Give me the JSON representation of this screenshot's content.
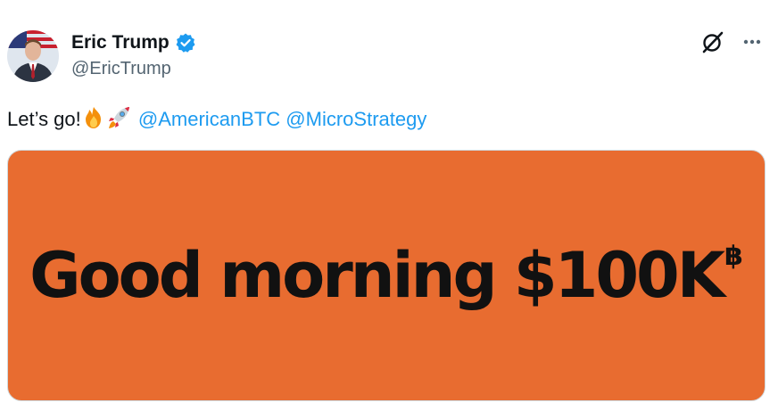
{
  "author": {
    "display_name": "Eric Trump",
    "handle": "@EricTrump",
    "verified_color": "#1d9bf0",
    "avatar_icon": "profile-photo"
  },
  "actions": {
    "grok_icon": "grok-icon",
    "more_icon": "more-dots-icon"
  },
  "tweet": {
    "text": "Let’s go!",
    "emoji_1": "fire-emoji",
    "emoji_2": "rocket-emoji",
    "mentions": [
      "@AmericanBTC",
      "@MicroStrategy"
    ]
  },
  "media": {
    "background_color": "#e86c30",
    "headline": "Good morning $100K",
    "headline_superscript": "฿"
  },
  "colors": {
    "link": "#1d9bf0",
    "secondary_text": "#536471",
    "primary_text": "#0f1419"
  }
}
